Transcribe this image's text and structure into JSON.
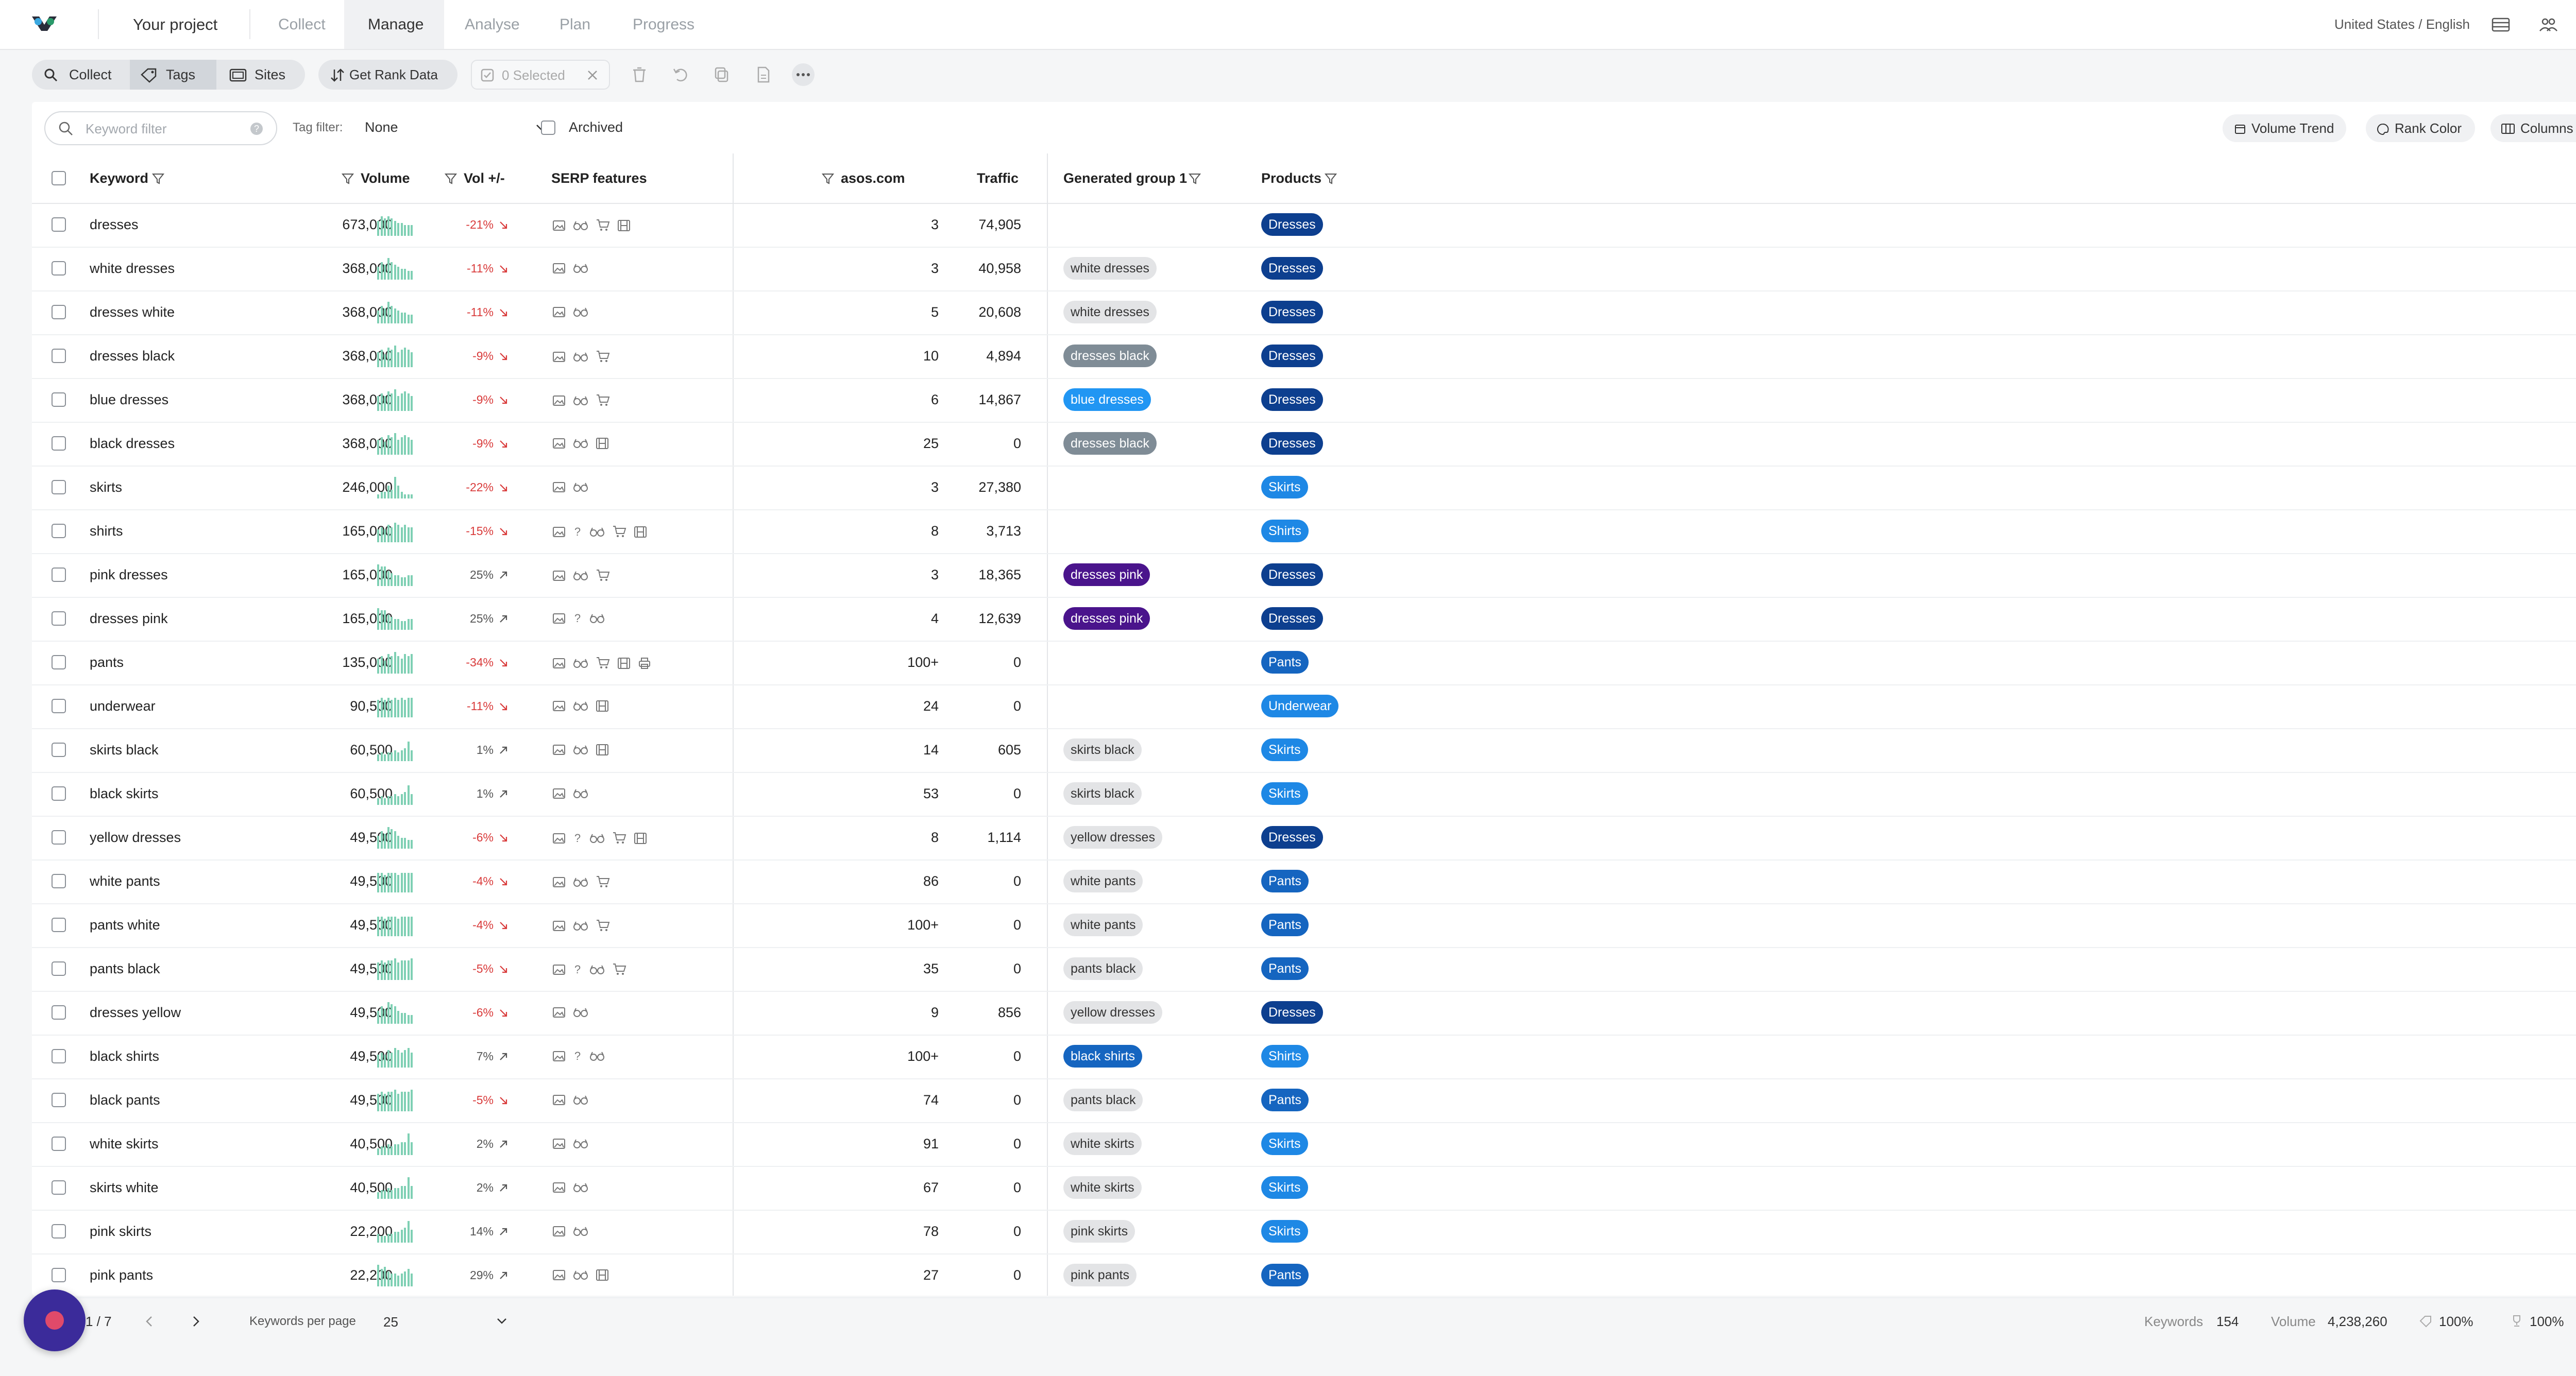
{
  "nav": {
    "project": "Your project",
    "tabs": [
      "Collect",
      "Manage",
      "Analyse",
      "Plan",
      "Progress"
    ],
    "active": "Manage",
    "locale": "United States / English"
  },
  "toolbar": {
    "collect": "Collect",
    "tags": "Tags",
    "sites": "Sites",
    "get_rank_data": "Get Rank Data",
    "selected": "0 Selected"
  },
  "filters": {
    "keyword_placeholder": "Keyword filter",
    "tag_filter_label": "Tag filter:",
    "tag_filter_value": "None",
    "archived_label": "Archived",
    "volume_trend": "Volume Trend",
    "rank_color": "Rank Color",
    "columns": "Columns"
  },
  "columns": {
    "keyword": "Keyword",
    "volume": "Volume",
    "vol_change": "Vol +/-",
    "serp": "SERP features",
    "site": "asos.com",
    "traffic": "Traffic",
    "group": "Generated group 1",
    "products": "Products"
  },
  "colors": {
    "spark": "#7fd0b4",
    "negative": "#d93b3b",
    "tag_gray": "#e3e4e6",
    "tag_slate": "#7f8c96",
    "tag_blue": "#2196f3",
    "tag_navy": "#0d3f8f",
    "tag_purple": "#4a148c",
    "tag_mid": "#1565c0",
    "prod_dark": "#0d3f8f",
    "prod_light": "#1e88e5"
  },
  "rows": [
    {
      "keyword": "dresses",
      "volume": "673,000",
      "delta": "-21%",
      "neg": true,
      "serp": [
        "img",
        "glasses",
        "cart",
        "film"
      ],
      "rank": "3",
      "traffic": "74,905",
      "group": "",
      "gstyle": "",
      "product": "Dresses",
      "pstyle": "dark",
      "spark": [
        0.7,
        0.9,
        0.8,
        0.9,
        0.8,
        0.7,
        0.6,
        0.6,
        0.5,
        0.5,
        0.5
      ]
    },
    {
      "keyword": "white dresses",
      "volume": "368,000",
      "delta": "-11%",
      "neg": true,
      "serp": [
        "img",
        "glasses"
      ],
      "rank": "3",
      "traffic": "40,958",
      "group": "white dresses",
      "gstyle": "gray",
      "product": "Dresses",
      "pstyle": "dark",
      "spark": [
        0.6,
        0.8,
        0.7,
        1.0,
        0.8,
        0.7,
        0.6,
        0.5,
        0.5,
        0.4,
        0.4
      ]
    },
    {
      "keyword": "dresses white",
      "volume": "368,000",
      "delta": "-11%",
      "neg": true,
      "serp": [
        "img",
        "glasses"
      ],
      "rank": "5",
      "traffic": "20,608",
      "group": "white dresses",
      "gstyle": "gray",
      "product": "Dresses",
      "pstyle": "dark",
      "spark": [
        0.6,
        0.8,
        0.7,
        1.0,
        0.8,
        0.7,
        0.6,
        0.5,
        0.5,
        0.4,
        0.4
      ]
    },
    {
      "keyword": "dresses black",
      "volume": "368,000",
      "delta": "-9%",
      "neg": true,
      "serp": [
        "img",
        "glasses",
        "cart"
      ],
      "rank": "10",
      "traffic": "4,894",
      "group": "dresses black",
      "gstyle": "slate",
      "product": "Dresses",
      "pstyle": "dark",
      "spark": [
        0.7,
        0.8,
        0.6,
        0.9,
        0.8,
        1.0,
        0.7,
        0.8,
        0.9,
        0.8,
        0.7
      ]
    },
    {
      "keyword": "blue dresses",
      "volume": "368,000",
      "delta": "-9%",
      "neg": true,
      "serp": [
        "img",
        "glasses",
        "cart"
      ],
      "rank": "6",
      "traffic": "14,867",
      "group": "blue dresses",
      "gstyle": "blue",
      "product": "Dresses",
      "pstyle": "dark",
      "spark": [
        0.7,
        0.8,
        0.7,
        0.9,
        0.8,
        1.0,
        0.7,
        0.8,
        0.9,
        0.8,
        0.7
      ]
    },
    {
      "keyword": "black dresses",
      "volume": "368,000",
      "delta": "-9%",
      "neg": true,
      "serp": [
        "img",
        "glasses",
        "film"
      ],
      "rank": "25",
      "traffic": "0",
      "group": "dresses black",
      "gstyle": "slate",
      "product": "Dresses",
      "pstyle": "dark",
      "spark": [
        0.7,
        0.8,
        0.6,
        0.9,
        0.8,
        1.0,
        0.7,
        0.8,
        0.9,
        0.8,
        0.7
      ]
    },
    {
      "keyword": "skirts",
      "volume": "246,000",
      "delta": "-22%",
      "neg": true,
      "serp": [
        "img",
        "glasses"
      ],
      "rank": "3",
      "traffic": "27,380",
      "group": "",
      "gstyle": "",
      "product": "Skirts",
      "pstyle": "light",
      "spark": [
        0.2,
        0.3,
        0.3,
        0.6,
        0.4,
        1.0,
        0.6,
        0.3,
        0.2,
        0.2,
        0.2
      ]
    },
    {
      "keyword": "shirts",
      "volume": "165,000",
      "delta": "-15%",
      "neg": true,
      "serp": [
        "img",
        "q",
        "glasses",
        "cart",
        "film"
      ],
      "rank": "8",
      "traffic": "3,713",
      "group": "",
      "gstyle": "",
      "product": "Shirts",
      "pstyle": "light",
      "spark": [
        0.6,
        0.7,
        0.6,
        0.8,
        0.7,
        0.9,
        0.8,
        0.7,
        0.8,
        0.7,
        0.7
      ]
    },
    {
      "keyword": "pink dresses",
      "volume": "165,000",
      "delta": "25%",
      "neg": false,
      "serp": [
        "img",
        "glasses",
        "cart"
      ],
      "rank": "3",
      "traffic": "18,365",
      "group": "dresses pink",
      "gstyle": "purple",
      "product": "Dresses",
      "pstyle": "dark",
      "spark": [
        1.0,
        0.9,
        0.9,
        0.7,
        0.6,
        0.5,
        0.5,
        0.4,
        0.4,
        0.5,
        0.5
      ]
    },
    {
      "keyword": "dresses pink",
      "volume": "165,000",
      "delta": "25%",
      "neg": false,
      "serp": [
        "img",
        "q",
        "glasses"
      ],
      "rank": "4",
      "traffic": "12,639",
      "group": "dresses pink",
      "gstyle": "purple",
      "product": "Dresses",
      "pstyle": "dark",
      "spark": [
        1.0,
        0.9,
        0.9,
        0.7,
        0.6,
        0.5,
        0.5,
        0.4,
        0.4,
        0.5,
        0.5
      ]
    },
    {
      "keyword": "pants",
      "volume": "135,000",
      "delta": "-34%",
      "neg": true,
      "serp": [
        "img",
        "glasses",
        "cart",
        "film",
        "print"
      ],
      "rank": "100+",
      "traffic": "0",
      "group": "",
      "gstyle": "",
      "product": "Pants",
      "pstyle": "mid",
      "spark": [
        0.7,
        0.8,
        0.6,
        0.9,
        0.8,
        1.0,
        0.8,
        0.7,
        0.9,
        0.8,
        0.9
      ]
    },
    {
      "keyword": "underwear",
      "volume": "90,500",
      "delta": "-11%",
      "neg": true,
      "serp": [
        "img",
        "glasses",
        "film"
      ],
      "rank": "24",
      "traffic": "0",
      "group": "",
      "gstyle": "",
      "product": "Underwear",
      "pstyle": "light",
      "spark": [
        0.8,
        0.9,
        0.8,
        0.9,
        0.8,
        0.9,
        0.8,
        0.9,
        0.8,
        0.9,
        0.9
      ]
    },
    {
      "keyword": "skirts black",
      "volume": "60,500",
      "delta": "1%",
      "neg": false,
      "serp": [
        "img",
        "glasses",
        "film"
      ],
      "rank": "14",
      "traffic": "605",
      "group": "skirts black",
      "gstyle": "gray",
      "product": "Skirts",
      "pstyle": "light",
      "spark": [
        0.3,
        0.4,
        0.3,
        0.4,
        0.4,
        0.5,
        0.4,
        0.5,
        0.6,
        0.9,
        0.5
      ]
    },
    {
      "keyword": "black skirts",
      "volume": "60,500",
      "delta": "1%",
      "neg": false,
      "serp": [
        "img",
        "glasses"
      ],
      "rank": "53",
      "traffic": "0",
      "group": "skirts black",
      "gstyle": "gray",
      "product": "Skirts",
      "pstyle": "light",
      "spark": [
        0.3,
        0.4,
        0.3,
        0.4,
        0.4,
        0.5,
        0.4,
        0.5,
        0.6,
        0.9,
        0.5
      ]
    },
    {
      "keyword": "yellow dresses",
      "volume": "49,500",
      "delta": "-6%",
      "neg": true,
      "serp": [
        "img",
        "q",
        "glasses",
        "cart",
        "film"
      ],
      "rank": "8",
      "traffic": "1,114",
      "group": "yellow dresses",
      "gstyle": "gray",
      "product": "Dresses",
      "pstyle": "dark",
      "spark": [
        0.6,
        0.8,
        0.7,
        1.0,
        0.9,
        0.8,
        0.6,
        0.5,
        0.5,
        0.4,
        0.4
      ]
    },
    {
      "keyword": "white pants",
      "volume": "49,500",
      "delta": "-4%",
      "neg": true,
      "serp": [
        "img",
        "glasses",
        "cart"
      ],
      "rank": "86",
      "traffic": "0",
      "group": "white pants",
      "gstyle": "gray",
      "product": "Pants",
      "pstyle": "mid",
      "spark": [
        0.9,
        0.9,
        0.8,
        0.9,
        0.9,
        0.9,
        0.8,
        0.9,
        0.9,
        0.9,
        0.9
      ]
    },
    {
      "keyword": "pants white",
      "volume": "49,500",
      "delta": "-4%",
      "neg": true,
      "serp": [
        "img",
        "glasses",
        "cart"
      ],
      "rank": "100+",
      "traffic": "0",
      "group": "white pants",
      "gstyle": "gray",
      "product": "Pants",
      "pstyle": "mid",
      "spark": [
        0.9,
        0.9,
        0.8,
        0.9,
        0.9,
        0.9,
        0.8,
        0.9,
        0.9,
        0.9,
        0.9
      ]
    },
    {
      "keyword": "pants black",
      "volume": "49,500",
      "delta": "-5%",
      "neg": true,
      "serp": [
        "img",
        "q",
        "glasses",
        "cart"
      ],
      "rank": "35",
      "traffic": "0",
      "group": "pants black",
      "gstyle": "gray",
      "product": "Pants",
      "pstyle": "mid",
      "spark": [
        0.8,
        0.9,
        0.8,
        0.9,
        0.9,
        1.0,
        0.8,
        0.9,
        0.9,
        0.9,
        1.0
      ]
    },
    {
      "keyword": "dresses yellow",
      "volume": "49,500",
      "delta": "-6%",
      "neg": true,
      "serp": [
        "img",
        "glasses"
      ],
      "rank": "9",
      "traffic": "856",
      "group": "yellow dresses",
      "gstyle": "gray",
      "product": "Dresses",
      "pstyle": "dark",
      "spark": [
        0.6,
        0.8,
        0.7,
        1.0,
        0.9,
        0.8,
        0.6,
        0.5,
        0.5,
        0.4,
        0.4
      ]
    },
    {
      "keyword": "black shirts",
      "volume": "49,500",
      "delta": "7%",
      "neg": false,
      "serp": [
        "img",
        "q",
        "glasses"
      ],
      "rank": "100+",
      "traffic": "0",
      "group": "black shirts",
      "gstyle": "mid",
      "product": "Shirts",
      "pstyle": "light",
      "spark": [
        0.6,
        0.7,
        0.6,
        0.8,
        0.7,
        0.9,
        0.8,
        0.7,
        0.8,
        0.9,
        0.7
      ]
    },
    {
      "keyword": "black pants",
      "volume": "49,500",
      "delta": "-5%",
      "neg": true,
      "serp": [
        "img",
        "glasses"
      ],
      "rank": "74",
      "traffic": "0",
      "group": "pants black",
      "gstyle": "gray",
      "product": "Pants",
      "pstyle": "mid",
      "spark": [
        0.8,
        0.9,
        0.8,
        0.9,
        0.9,
        1.0,
        0.8,
        0.9,
        0.9,
        0.9,
        1.0
      ]
    },
    {
      "keyword": "white skirts",
      "volume": "40,500",
      "delta": "2%",
      "neg": false,
      "serp": [
        "img",
        "glasses"
      ],
      "rank": "91",
      "traffic": "0",
      "group": "white skirts",
      "gstyle": "gray",
      "product": "Skirts",
      "pstyle": "light",
      "spark": [
        0.3,
        0.4,
        0.4,
        0.5,
        0.4,
        0.5,
        0.5,
        0.6,
        0.6,
        1.0,
        0.6
      ]
    },
    {
      "keyword": "skirts white",
      "volume": "40,500",
      "delta": "2%",
      "neg": false,
      "serp": [
        "img",
        "glasses"
      ],
      "rank": "67",
      "traffic": "0",
      "group": "white skirts",
      "gstyle": "gray",
      "product": "Skirts",
      "pstyle": "light",
      "spark": [
        0.3,
        0.4,
        0.4,
        0.5,
        0.4,
        0.5,
        0.5,
        0.6,
        0.6,
        1.0,
        0.6
      ]
    },
    {
      "keyword": "pink skirts",
      "volume": "22,200",
      "delta": "14%",
      "neg": false,
      "serp": [
        "img",
        "glasses"
      ],
      "rank": "78",
      "traffic": "0",
      "group": "pink skirts",
      "gstyle": "gray",
      "product": "Skirts",
      "pstyle": "light",
      "spark": [
        0.4,
        0.3,
        0.3,
        0.4,
        0.4,
        0.5,
        0.5,
        0.6,
        0.7,
        1.0,
        0.6
      ]
    },
    {
      "keyword": "pink pants",
      "volume": "22,200",
      "delta": "29%",
      "neg": false,
      "serp": [
        "img",
        "glasses",
        "film"
      ],
      "rank": "27",
      "traffic": "0",
      "group": "pink pants",
      "gstyle": "gray",
      "product": "Pants",
      "pstyle": "mid",
      "spark": [
        1.0,
        0.8,
        0.9,
        0.7,
        0.6,
        0.6,
        0.5,
        0.6,
        0.7,
        0.8,
        0.6
      ]
    }
  ],
  "footer": {
    "page": "1 / 7",
    "per_page_label": "Keywords per page",
    "per_page_value": "25",
    "keywords_label": "Keywords",
    "keywords_value": "154",
    "volume_label": "Volume",
    "volume_value": "4,238,260",
    "pct1": "100%",
    "pct2": "100%"
  }
}
